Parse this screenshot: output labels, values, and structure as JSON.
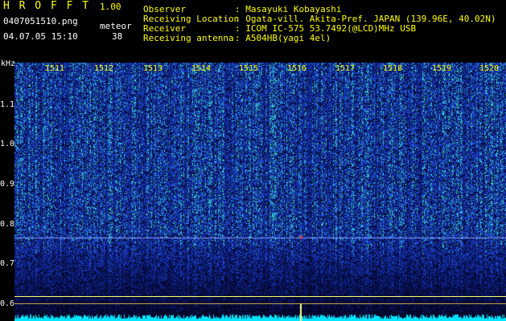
{
  "header": {
    "app_title": "H R O F F T",
    "app_version": "1.00",
    "filename": "0407051510.png",
    "datetime": "04.07.05 15:10",
    "meteor_label": "meteor",
    "meteor_count": "38",
    "info_labels": [
      "Observer",
      "Receiving Location",
      "Receiver",
      "Receiving antenna"
    ],
    "info_values": [
      ": Masayuki Kobayashi",
      ": Ogata-vill. Akita-Pref. JAPAN (139.96E, 40.02N)",
      ": ICOM IC-575 53.7492(@LCD)MHz USB",
      ": A504HB(yagi 4el)"
    ]
  },
  "axis": {
    "unit": "kHz",
    "y_labels": [
      "1.1",
      "1.0",
      "0.9",
      "0.8",
      "0.7",
      "0.6"
    ],
    "minute_labels": [
      "1511",
      "1512",
      "1513",
      "1514",
      "1515",
      "1516",
      "1517",
      "1518",
      "1519",
      "1520"
    ]
  },
  "colors": {
    "background": "#000000",
    "spectrogram_low": "#0a1a6e",
    "spectrogram_mid": "#1e4fd8",
    "spectrogram_high": "#3cf0d8",
    "signal_line": "#7fa0ff",
    "meteor_mark": "#ff4040",
    "baseline_bars": "#00e6ff"
  }
}
